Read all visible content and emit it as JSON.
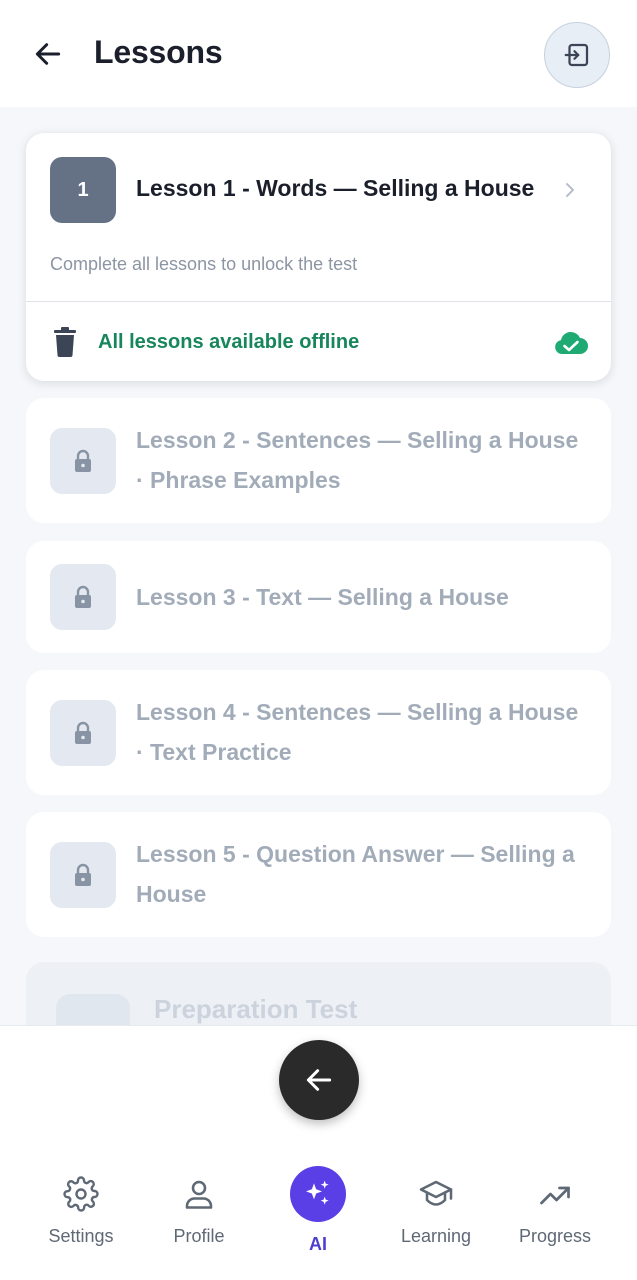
{
  "header": {
    "title": "Lessons",
    "back_icon": "arrow-left-icon",
    "exit_icon": "exit-icon"
  },
  "lessons": {
    "active": {
      "number": "1",
      "title": "Lesson 1 - Words — Selling a House",
      "note": "Complete all lessons to unlock the test",
      "offline_text": "All lessons available offline"
    },
    "locked": [
      {
        "line1": "Lesson 2 - Sentences — Selling a House",
        "line2": "· Phrase Examples"
      },
      {
        "line1": "Lesson 3 - Text — Selling a House",
        "line2": ""
      },
      {
        "line1": "Lesson 4 - Sentences — Selling a House",
        "line2": "· Text Practice"
      },
      {
        "line1": "Lesson 5 - Question Answer — Selling a",
        "line2": "House"
      }
    ],
    "preparation_test": "Preparation Test"
  },
  "bottom_nav": {
    "items": [
      {
        "label": "Settings",
        "icon": "gear-icon"
      },
      {
        "label": "Profile",
        "icon": "user-icon"
      },
      {
        "label": "AI",
        "icon": "sparkles-icon"
      },
      {
        "label": "Learning",
        "icon": "graduation-cap-icon"
      },
      {
        "label": "Progress",
        "icon": "trending-up-icon"
      }
    ]
  },
  "colors": {
    "accent_purple": "#5b3fe6",
    "offline_green": "#17865c",
    "badge_gray": "#657286"
  }
}
